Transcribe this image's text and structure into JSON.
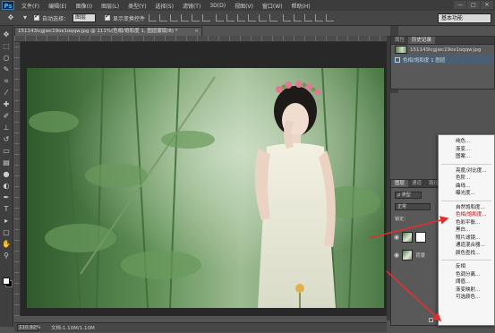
{
  "app": {
    "logo": "Ps"
  },
  "menubar": {
    "items": [
      "文件(F)",
      "编辑(E)",
      "图像(I)",
      "图层(L)",
      "类型(Y)",
      "选择(S)",
      "滤镜(T)",
      "3D(D)",
      "视图(V)",
      "窗口(W)",
      "帮助(H)"
    ],
    "window_controls": [
      "—",
      "□",
      "✕"
    ]
  },
  "options": {
    "auto_select_label": "自动选择：",
    "auto_select_value": "图层",
    "show_transform_label": "显示变换控件",
    "workspace": "基本功能"
  },
  "document": {
    "tab_title": "151143lcgjwc19os1oqqw.jpg @ 111%(色相/饱和度 1, 图层蒙版/8) *",
    "zoom": "110.92%",
    "doc_info": "文档:1.10M/1.10M"
  },
  "history_panel": {
    "tabs": [
      "属性",
      "历史记录"
    ],
    "items": [
      {
        "label": "151143lcgjwc19os1oqqw.jpg"
      },
      {
        "label": "色相/饱和度 1 图层"
      }
    ]
  },
  "layers_panel": {
    "tabs": [
      "图层",
      "通道",
      "路径"
    ],
    "filter_label": "ρ 类型",
    "blend_mode": "正常",
    "lock_label": "锁定：",
    "layer_name": "背景"
  },
  "adjust_menu": {
    "items": [
      "纯色...",
      "渐变...",
      "图案...",
      "-",
      "亮度/对比度...",
      "色阶...",
      "曲线...",
      "曝光度...",
      "-",
      "自然饱和度...",
      "色相/饱和度...",
      "色彩平衡...",
      "黑白...",
      "照片滤镜...",
      "通道混合器...",
      "颜色查找...",
      "-",
      "反相",
      "色调分离...",
      "阈值...",
      "渐变映射...",
      "可选颜色..."
    ],
    "highlighted": "色相/饱和度...",
    "highlight_color": "#c40000"
  },
  "colors": {
    "accent": "#e12f2f",
    "selection": "#4b5f74"
  }
}
